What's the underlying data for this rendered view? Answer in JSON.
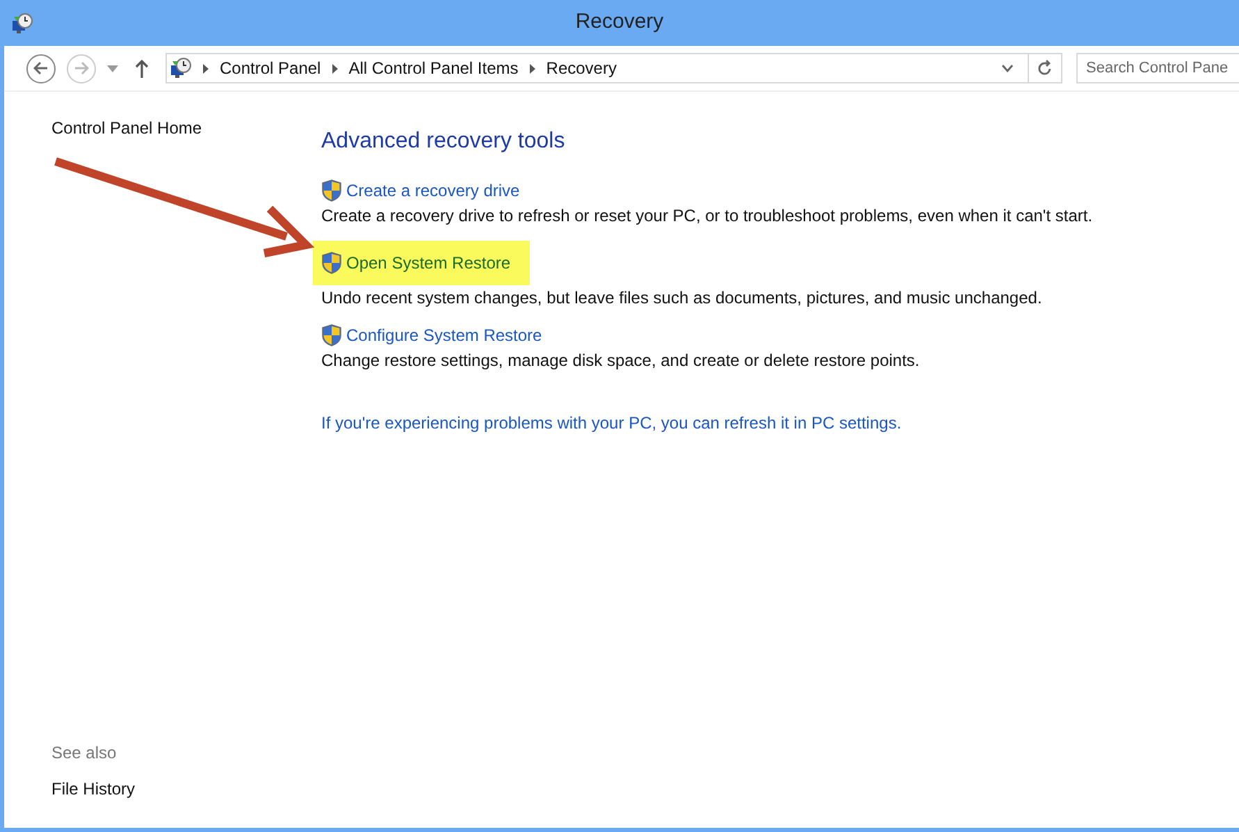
{
  "window": {
    "title": "Recovery"
  },
  "address_bar": {
    "crumbs": [
      "Control Panel",
      "All Control Panel Items",
      "Recovery"
    ]
  },
  "search": {
    "placeholder": "Search Control Pane"
  },
  "sidebar": {
    "home": "Control Panel Home",
    "see_also": "See also",
    "links": [
      "File History"
    ]
  },
  "heading": "Advanced recovery tools",
  "tools": [
    {
      "label": "Create a recovery drive",
      "description": "Create a recovery drive to refresh or reset your PC, or to troubleshoot problems, even when it can't start.",
      "highlighted": false
    },
    {
      "label": "Open System Restore",
      "description": "Undo recent system changes, but leave files such as documents, pictures, and music unchanged.",
      "highlighted": true
    },
    {
      "label": "Configure System Restore",
      "description": "Change restore settings, manage disk space, and create or delete restore points.",
      "highlighted": false
    }
  ],
  "refresh_link": "If you're experiencing problems with your PC, you can refresh it in PC settings."
}
